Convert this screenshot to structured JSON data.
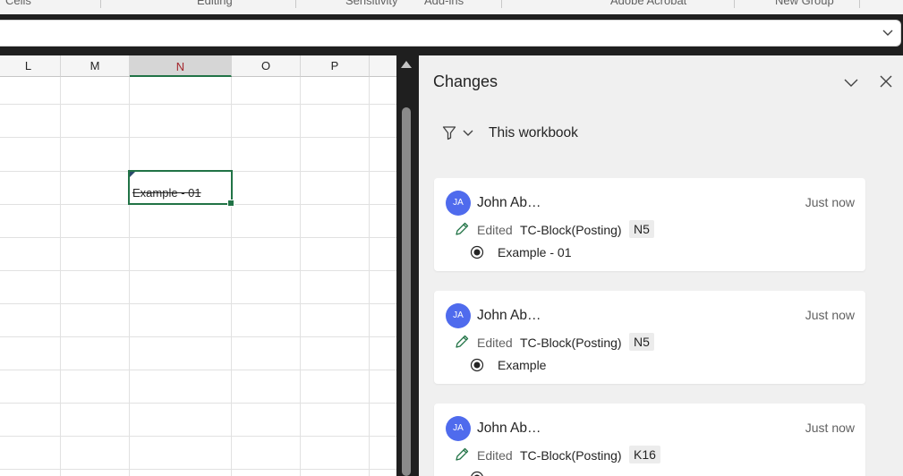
{
  "ribbon": {
    "groups": [
      "Cells",
      "Editing",
      "Sensitivity",
      "Add-ins",
      "Adobe Acrobat",
      "New Group"
    ]
  },
  "grid": {
    "columns": [
      "L",
      "M",
      "N",
      "O",
      "P"
    ],
    "selected_column": "N",
    "active_cell_value": "Example - 01"
  },
  "changes_pane": {
    "title": "Changes",
    "filter_label": "This workbook",
    "cards": [
      {
        "initials": "JA",
        "author": "John Ab…",
        "time": "Just now",
        "action": "Edited",
        "sheet": "TC-Block(Posting)",
        "cell": "N5",
        "value": "Example - 01"
      },
      {
        "initials": "JA",
        "author": "John Ab…",
        "time": "Just now",
        "action": "Edited",
        "sheet": "TC-Block(Posting)",
        "cell": "N5",
        "value": "Example"
      },
      {
        "initials": "JA",
        "author": "John Ab…",
        "time": "Just now",
        "action": "Edited",
        "sheet": "TC-Block(Posting)",
        "cell": "K16",
        "value": ""
      }
    ]
  },
  "colors": {
    "excel_green": "#217346",
    "avatar_blue": "#4f6bed",
    "pane_background": "#f0f0f0"
  }
}
